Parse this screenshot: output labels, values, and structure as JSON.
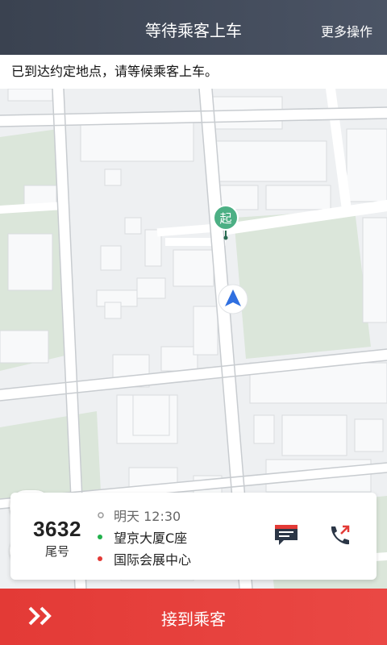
{
  "header": {
    "title": "等待乘客上车",
    "more_label": "更多操作"
  },
  "notice": {
    "text": "已到达约定地点，请等候乘客上车。"
  },
  "map": {
    "start_marker_label": "起"
  },
  "order": {
    "tail_number": "3632",
    "tail_label": "尾号",
    "time": "明天 12:30",
    "pickup": "望京大厦C座",
    "dropoff": "国际会展中心",
    "pickup_dot_color": "#22b14c",
    "dropoff_dot_color": "#e33a36"
  },
  "footer": {
    "action_label": "接到乘客"
  },
  "colors": {
    "accent": "#e33a36",
    "header_bg": "#3f4756",
    "marker_green": "#4caf84",
    "nav_blue": "#2f6fe0"
  }
}
